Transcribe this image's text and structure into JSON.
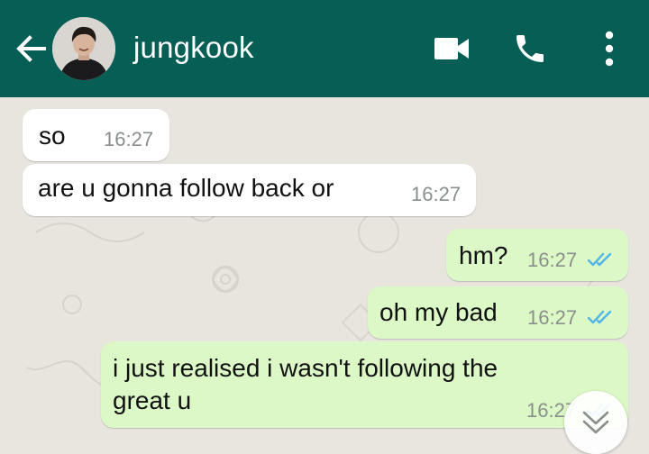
{
  "header": {
    "contact_name": "jungkook",
    "icons": {
      "back": "arrow-left-icon",
      "video": "video-camera-icon",
      "call": "phone-icon",
      "menu": "more-vertical-icon"
    },
    "background_color": "#075e54"
  },
  "messages": [
    {
      "direction": "incoming",
      "text": "so",
      "time": "16:27"
    },
    {
      "direction": "incoming",
      "text": "are u gonna follow back or",
      "time": "16:27"
    },
    {
      "direction": "outgoing",
      "text": "hm?",
      "time": "16:27",
      "status": "read"
    },
    {
      "direction": "outgoing",
      "text": "oh my bad",
      "time": "16:27",
      "status": "read"
    },
    {
      "direction": "outgoing",
      "text_lines": [
        "i just realised i wasn't following the",
        "great u"
      ],
      "time": "16:27",
      "status": "read"
    }
  ],
  "colors": {
    "incoming_bubble": "#ffffff",
    "outgoing_bubble": "#dcf8c6",
    "read_ticks": "#4fb6ec",
    "timestamp": "#8a8f8c"
  },
  "scroll_button": {
    "icon": "double-chevron-down-icon"
  }
}
